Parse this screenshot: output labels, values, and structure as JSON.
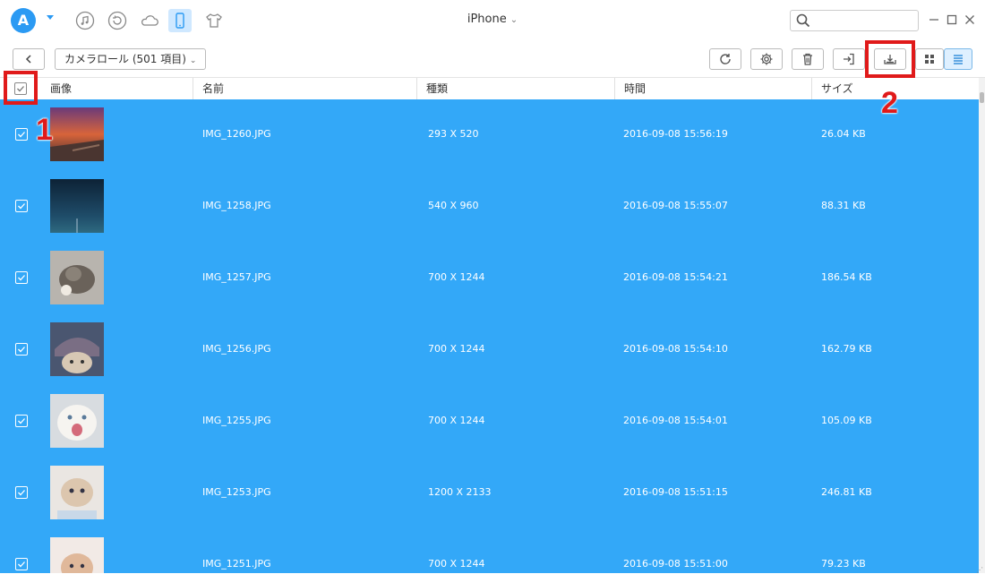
{
  "titlebar": {
    "logo_letter": "A",
    "device_name": "iPhone",
    "icons": [
      "music-note-icon",
      "restore-icon",
      "cloud-icon",
      "phone-icon",
      "tshirt-icon"
    ],
    "search_placeholder": ""
  },
  "toolbar": {
    "album_label": "カメラロール (501 項目)",
    "buttons": [
      "refresh-icon",
      "settings-icon",
      "trash-icon",
      "import-icon",
      "export-to-pc-icon",
      "grid-view-icon",
      "list-view-icon"
    ]
  },
  "table": {
    "columns": [
      "画像",
      "名前",
      "種類",
      "時間",
      "サイズ"
    ],
    "rows": [
      {
        "name": "IMG_1260.JPG",
        "type": "293 X 520",
        "time": "2016-09-08 15:56:19",
        "size": "26.04 KB",
        "thumb": "sunset"
      },
      {
        "name": "IMG_1258.JPG",
        "type": "540 X 960",
        "time": "2016-09-08 15:55:07",
        "size": "88.31 KB",
        "thumb": "night"
      },
      {
        "name": "IMG_1257.JPG",
        "type": "700 X 1244",
        "time": "2016-09-08 15:54:21",
        "size": "186.54 KB",
        "thumb": "cat-gray"
      },
      {
        "name": "IMG_1256.JPG",
        "type": "700 X 1244",
        "time": "2016-09-08 15:54:10",
        "size": "162.79 KB",
        "thumb": "cat-hat"
      },
      {
        "name": "IMG_1255.JPG",
        "type": "700 X 1244",
        "time": "2016-09-08 15:54:01",
        "size": "105.09 KB",
        "thumb": "cat-white"
      },
      {
        "name": "IMG_1253.JPG",
        "type": "1200 X 2133",
        "time": "2016-09-08 15:51:15",
        "size": "246.81 KB",
        "thumb": "kitten"
      },
      {
        "name": "IMG_1251.JPG",
        "type": "700 X 1244",
        "time": "2016-09-08 15:51:00",
        "size": "79.23 KB",
        "thumb": "kitten-pink"
      }
    ]
  },
  "annotations": {
    "step1": "1",
    "step2": "2"
  },
  "colors": {
    "selection": "#33a8f8",
    "accent": "#2b9af3",
    "highlight": "#e01a1a"
  }
}
